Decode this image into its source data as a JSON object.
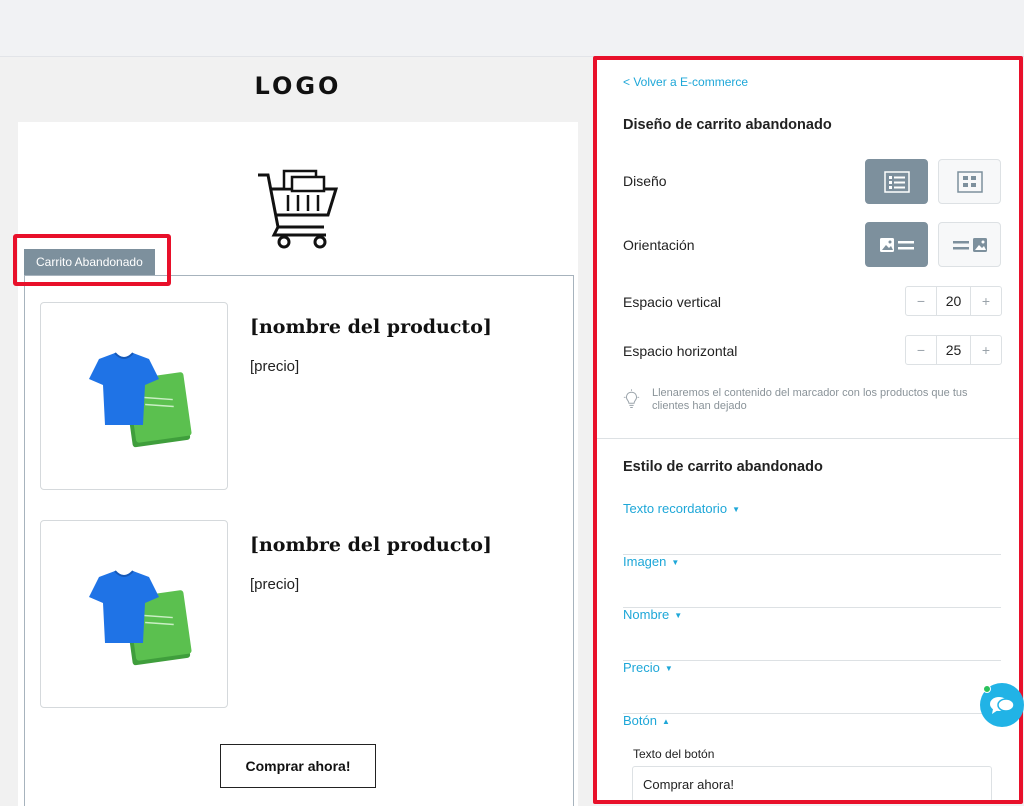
{
  "preview": {
    "logo_text": "LOGO",
    "block_tag": "Carrito Abandonado",
    "products": [
      {
        "name": "[nombre del producto]",
        "price": "[precio]"
      },
      {
        "name": "[nombre del producto]",
        "price": "[precio]"
      }
    ],
    "buy_button": "Comprar ahora!"
  },
  "panel": {
    "back_link": "< Volver a E-commerce",
    "design_title": "Diseño de carrito abandonado",
    "design_label": "Diseño",
    "orientation_label": "Orientación",
    "vertical_space": {
      "label": "Espacio vertical",
      "value": "20",
      "minus": "−",
      "plus": "+"
    },
    "horizontal_space": {
      "label": "Espacio horizontal",
      "value": "25",
      "minus": "−",
      "plus": "+"
    },
    "hint": "Llenaremos el contenido del marcador con los productos que tus clientes han dejado",
    "style_title": "Estilo de carrito abandonado",
    "accordions": [
      {
        "label": "Texto recordatorio",
        "caret": "▼"
      },
      {
        "label": "Imagen",
        "caret": "▼"
      },
      {
        "label": "Nombre",
        "caret": "▼"
      },
      {
        "label": "Precio",
        "caret": "▼"
      },
      {
        "label": "Botón",
        "caret": "▲"
      }
    ],
    "button_text_label": "Texto del botón",
    "button_text_value": "Comprar ahora!"
  },
  "colors": {
    "accent": "#1ea7d8",
    "highlight": "#e8102a",
    "selected": "#7d909d"
  }
}
